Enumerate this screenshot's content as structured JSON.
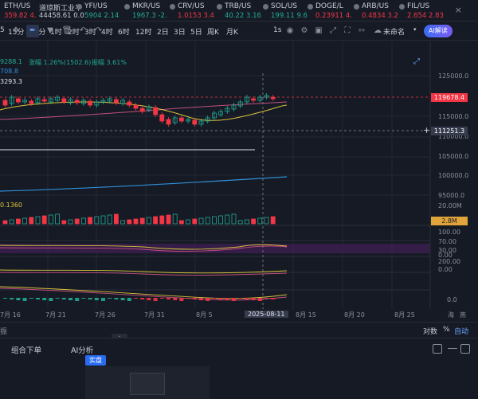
{
  "ticker": {
    "items": [
      {
        "name": "ETH/US",
        "price": "359.82 4.",
        "color": "red"
      },
      {
        "name": "道琼斯工业平",
        "price": "44458.61 0.0",
        "color": "gray"
      },
      {
        "name": "YFI/US",
        "price": "5904 2.14",
        "color": "green"
      },
      {
        "name": "MKR/US",
        "price": "1967.3 -2.",
        "color": "green"
      },
      {
        "name": "CRV/US",
        "price": "1.0153 3.4",
        "color": "red"
      },
      {
        "name": "TRB/US",
        "price": "40.22 3.16",
        "color": "green"
      },
      {
        "name": "SOL/US",
        "price": "199.11 9.6",
        "color": "green"
      },
      {
        "name": "DOGE/L",
        "price": "0.23911 4.",
        "color": "red"
      },
      {
        "name": "ARB/US",
        "price": "0.4834 3.2",
        "color": "red"
      },
      {
        "name": "FIL/US",
        "price": "2.654 2.83",
        "color": "red"
      }
    ],
    "close": "×"
  },
  "toolbar": {
    "timeframes": [
      "15分",
      "30分",
      "1时",
      "2时",
      "3时",
      "4时",
      "6时",
      "12时",
      "2日",
      "3日",
      "5日",
      "周K",
      "月K"
    ],
    "first_icon": "5",
    "right_label": "1s",
    "unnamed_label": "未命名",
    "ai_label": "AI解读"
  },
  "chart": {
    "info_line1_left": "9288.1",
    "info_line1_mid": "涨幅 1.26%(1502.6)",
    "info_line1_right": "振幅 3.61%",
    "info_line2": "708.8",
    "info_line3": "3293.3",
    "price_labels": [
      "125000.0",
      "115000.0",
      "110000.0",
      "105000.0",
      "100000.0",
      "95000.0",
      "20.00M"
    ],
    "tag_current": "119678.4",
    "tag_cursor": "111251.3",
    "tag_volume": "2.8M",
    "osc_labels": [
      "100.00",
      "70.00",
      "30.00",
      "0.00"
    ],
    "osc2_labels": [
      "200.00",
      "0.00"
    ],
    "vol_indicator": "0.1360",
    "macd_label": "0.0",
    "colors": {
      "up": "#22ab94",
      "down": "#f23645",
      "ma1": "#d8c23a",
      "ma2": "#c0507a",
      "ma3": "#2f8fd6"
    }
  },
  "xaxis": {
    "labels": [
      "7月 16",
      "7月 21",
      "7月 26",
      "7月 31",
      "8月 5",
      "2025-08-11",
      "8月 15",
      "8月 20",
      "8月 25"
    ],
    "highlight": "2025-08-11",
    "right1": "海",
    "right2": "燕"
  },
  "bottombar": {
    "left": "振",
    "log_label": "对数",
    "pct_label": "%",
    "auto_label": "自动"
  },
  "dock": {
    "tab1": "组合下单",
    "tab2": "AI分析",
    "live_badge": "实盘"
  }
}
